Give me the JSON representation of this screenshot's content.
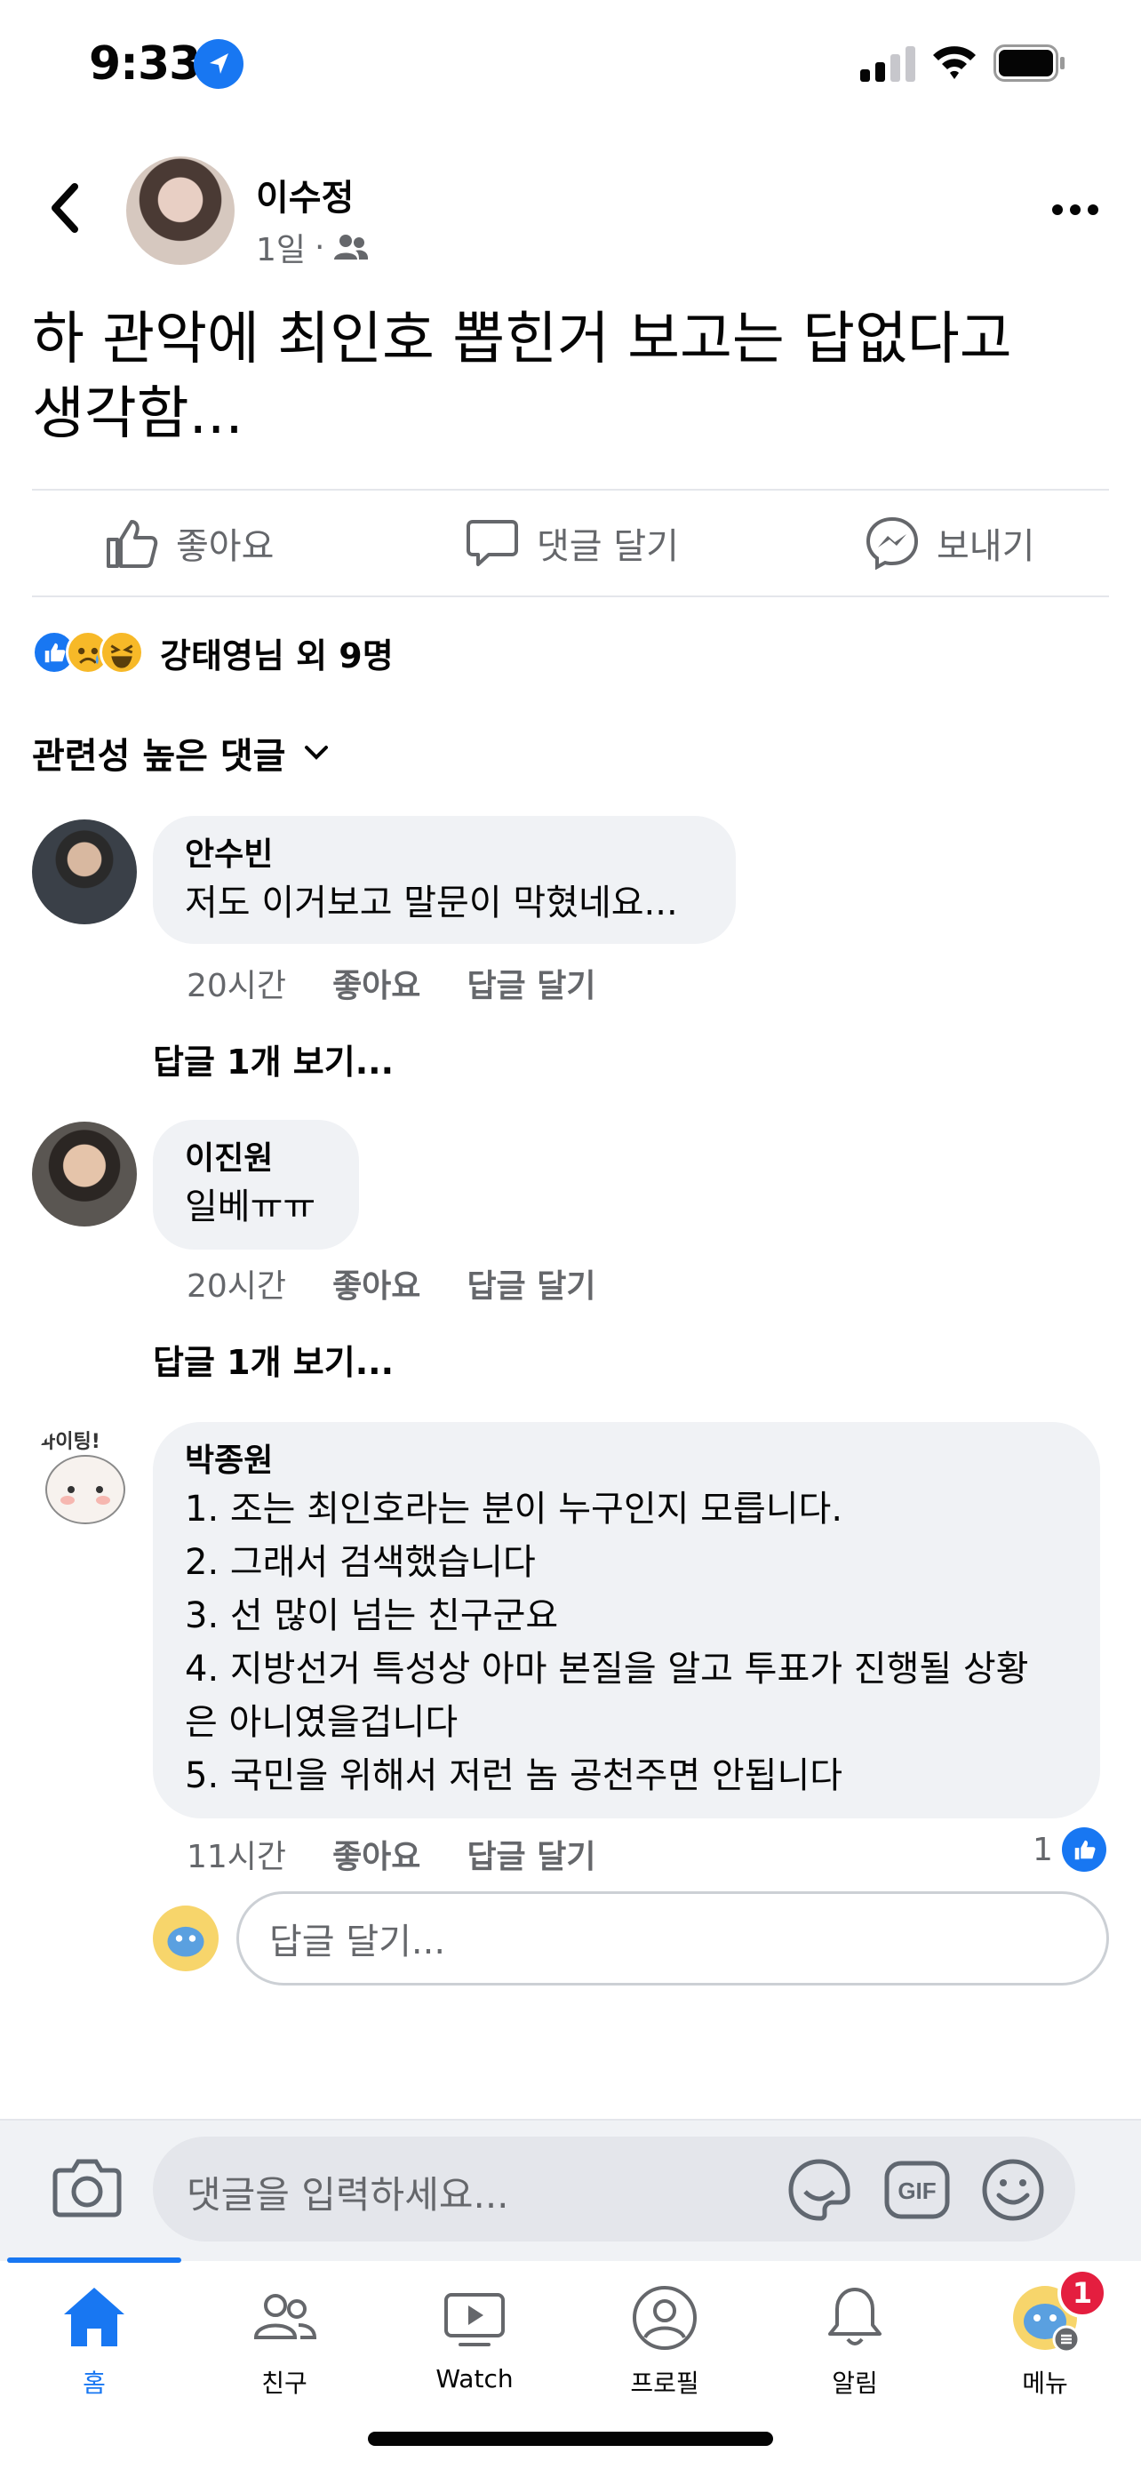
{
  "status_bar": {
    "time": "9:33"
  },
  "post": {
    "author": "이수정",
    "age": "1일",
    "audience_icon": "friends-icon",
    "text_line1": "하 관악에 최인호 뽑힌거 보고는 답없다고",
    "text_line2": "생각함..."
  },
  "actions": {
    "like": "좋아요",
    "comment": "댓글 달기",
    "send": "보내기"
  },
  "reactions": {
    "summary": "강태영님 외 9명",
    "types": [
      "like",
      "sad",
      "haha"
    ]
  },
  "comments_sort": "관련성 높은 댓글",
  "comments": [
    {
      "author": "안수빈",
      "text": "저도 이거보고 말문이 막혔네요...",
      "time": "20시간",
      "like_label": "좋아요",
      "reply_label": "답글 달기",
      "view_replies": "답글 1개 보기..."
    },
    {
      "author": "이진원",
      "text": "일베ㅠㅠ",
      "time": "20시간",
      "like_label": "좋아요",
      "reply_label": "답글 달기",
      "view_replies": "답글 1개 보기..."
    },
    {
      "author": "박종원",
      "lines": [
        "1. 조는 최인호라는 분이 누구인지 모릅니다.",
        "2. 그래서 검색했습니다",
        "3. 선 많이 넘는 친구군요",
        "4. 지방선거 특성상 아마 본질을 알고 투표가 진행될 상황",
        "은 아니였을겁니다",
        "5. 국민을 위해서 저런 놈 공천주면 안됩니다"
      ],
      "time": "11시간",
      "like_label": "좋아요",
      "reply_label": "답글 달기",
      "like_count": "1",
      "avatar_text": "파이팅!"
    }
  ],
  "reply_input": {
    "placeholder": "답글 달기..."
  },
  "composer": {
    "placeholder": "댓글을 입력하세요..."
  },
  "tabs": [
    {
      "label": "홈",
      "icon": "home-icon",
      "active": true
    },
    {
      "label": "친구",
      "icon": "friends-icon"
    },
    {
      "label": "Watch",
      "icon": "watch-icon"
    },
    {
      "label": "프로필",
      "icon": "profile-icon"
    },
    {
      "label": "알림",
      "icon": "bell-icon"
    },
    {
      "label": "메뉴",
      "icon": "menu-icon",
      "badge": "1"
    }
  ],
  "colors": {
    "accent": "#1877f2",
    "badge": "#e41e3f",
    "bubble": "#f0f2f5"
  }
}
